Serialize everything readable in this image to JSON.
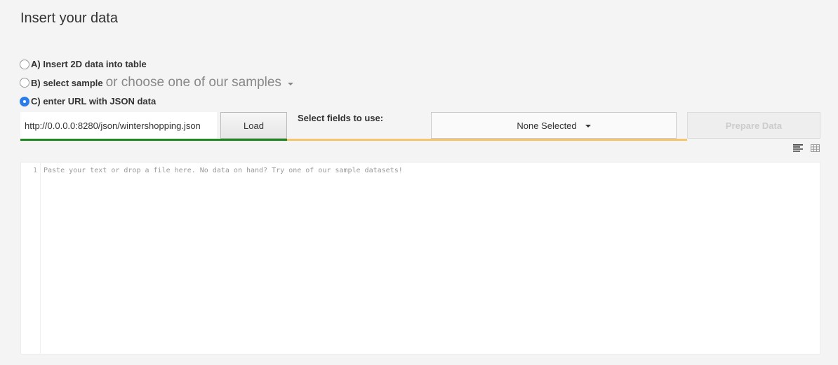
{
  "page": {
    "title": "Insert your data"
  },
  "options": [
    {
      "label": "A) Insert 2D data into table",
      "checked": false
    },
    {
      "label": "B) select sample",
      "checked": false,
      "extra": "or choose one of our samples"
    },
    {
      "label": "C) enter URL with JSON data",
      "checked": true
    }
  ],
  "url_input": {
    "value": "http://0.0.0.0:8280/json/wintershopping.json"
  },
  "load_button": {
    "label": "Load"
  },
  "fields": {
    "label": "Select fields to use:",
    "dropdown_value": "None Selected"
  },
  "prepare_button": {
    "label": "Prepare Data"
  },
  "editor": {
    "line_number": "1",
    "placeholder": "Paste your text or drop a file here. No data on hand? Try one of our sample datasets!"
  },
  "colors": {
    "accent_green": "#1e8a1e",
    "accent_yellow": "#f5c56a",
    "radio_blue": "#2b7de9"
  },
  "icons": {
    "text_view": "align-left-icon",
    "table_view": "table-grid-icon"
  }
}
